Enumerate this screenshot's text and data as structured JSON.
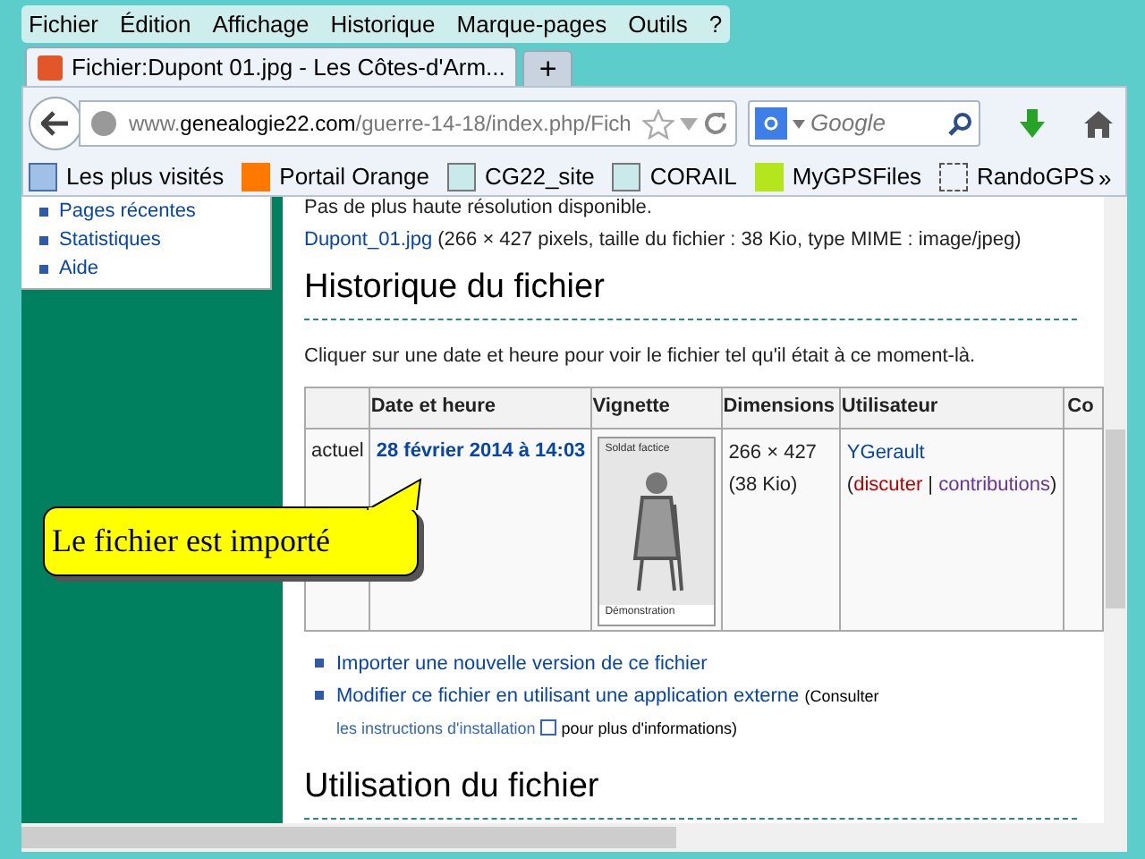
{
  "menu_bar": [
    "Fichier",
    "Édition",
    "Affichage",
    "Historique",
    "Marque-pages",
    "Outils",
    "?"
  ],
  "tabs": [
    {
      "label": "Fichier:Dupont 01.jpg - Les Côtes-d'Arm...",
      "selected": true
    },
    {
      "label": "+",
      "selected": false
    }
  ],
  "address_bar": {
    "domain_prefix": "www.",
    "domain": "genealogie22.com",
    "path": "/guerre-14-18/index.php/Fich"
  },
  "search": {
    "placeholder": "Google"
  },
  "bookmarks": [
    "Les plus visités",
    "Portail Orange",
    "CG22_site",
    "CORAIL",
    "MyGPSFiles",
    "RandoGPS"
  ],
  "bookmarks_overflow": "»",
  "sidebar": {
    "items": [
      "Pages récentes",
      "Statistiques",
      "Aide"
    ]
  },
  "content": {
    "resolution_note": "Pas de plus haute résolution disponible.",
    "file_link": "Dupont_01.jpg",
    "file_info": " (266 × 427 pixels, taille du fichier : 38 Kio, type MIME : image/jpeg)",
    "history_heading": "Historique du fichier",
    "history_intro": "Cliquer sur une date et heure pour voir le fichier tel qu'il était à ce moment-là.",
    "table": {
      "columns": [
        "",
        "Date et heure",
        "Vignette",
        "Dimensions",
        "Utilisateur",
        "Co"
      ],
      "rows": [
        {
          "status": "actuel",
          "date": "28 février 2014 à 14:03",
          "thumbnail_caption_top": "Soldat factice",
          "thumbnail_caption_bottom": "Démonstration",
          "dimensions": "266 × 427",
          "size": "(38 Kio)",
          "user": "YGerault",
          "links_open": "(",
          "talk": "discuter",
          "links_separator": " | ",
          "contribs": "contributions",
          "links_close": ")"
        }
      ]
    },
    "actions": [
      {
        "kind": "link",
        "text": "Importer une nouvelle version de ce fichier"
      },
      {
        "kind": "external",
        "text": "Modifier ce fichier en utilisant une application externe",
        "note_before": "(Consulter ",
        "note_link": "les instructions d'installation",
        "note_after": " pour plus d'informations)"
      }
    ],
    "usage_heading": "Utilisation du fichier"
  },
  "callout": "Le fichier est importé"
}
